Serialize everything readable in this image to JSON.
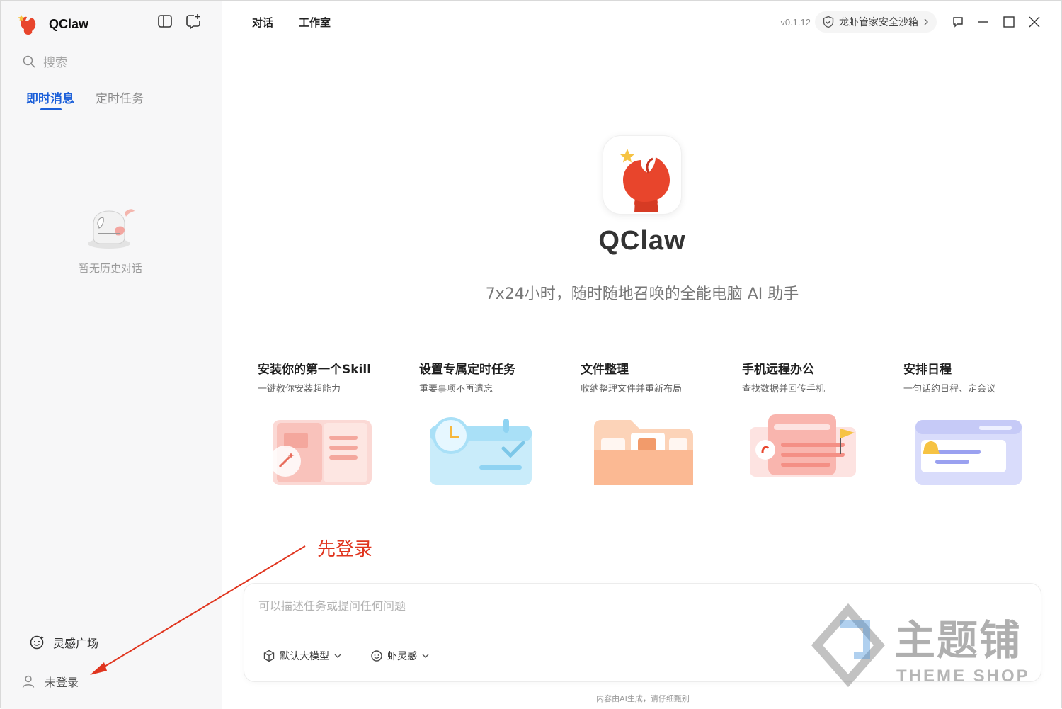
{
  "app": {
    "name": "QClaw",
    "version": "v0.1.12"
  },
  "sidebar": {
    "search_placeholder": "搜索",
    "tabs": [
      {
        "label": "即时消息",
        "active": true
      },
      {
        "label": "定时任务",
        "active": false
      }
    ],
    "empty_text": "暂无历史对话",
    "inspiration_label": "灵感广场",
    "login_label": "未登录"
  },
  "topbar": {
    "tabs": [
      {
        "label": "对话"
      },
      {
        "label": "工作室"
      }
    ],
    "sandbox_label": "龙虾管家安全沙箱"
  },
  "hero": {
    "title": "QClaw",
    "subtitle": "7x24小时，随时随地召唤的全能电脑 AI 助手"
  },
  "cards": [
    {
      "title": "安装你的第一个Skill",
      "desc": "一键教你安装超能力"
    },
    {
      "title": "设置专属定时任务",
      "desc": "重要事项不再遗忘"
    },
    {
      "title": "文件整理",
      "desc": "收纳整理文件并重新布局"
    },
    {
      "title": "手机远程办公",
      "desc": "查找数据并回传手机"
    },
    {
      "title": "安排日程",
      "desc": "一句话约日程、定会议"
    }
  ],
  "annotation": "先登录",
  "composer": {
    "placeholder": "可以描述任务或提问任何问题",
    "model_label": "默认大模型",
    "inspiration_label": "虾灵感"
  },
  "footer_note": "内容由AI生成，请仔细甄别",
  "watermark": {
    "title": "主题铺",
    "subtitle": "THEME SHOP"
  },
  "colors": {
    "accent": "#1b5fd9",
    "brand_red": "#e8452c",
    "annotation_red": "#e0351f"
  }
}
